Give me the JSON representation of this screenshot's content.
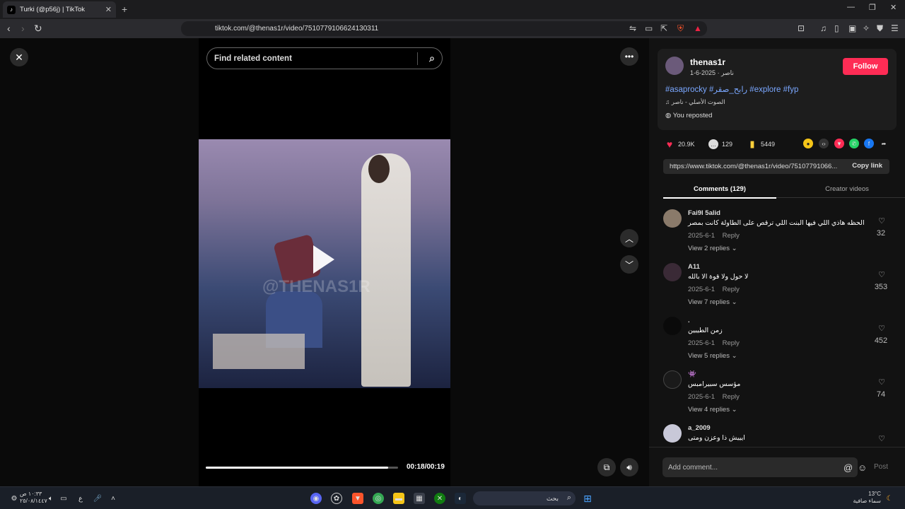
{
  "browser": {
    "tab_title": "Turki (@p56j) | TikTok",
    "url": "tiktok.com/@thenas1r/video/7510779106624130311"
  },
  "player": {
    "search_placeholder": "Find related content",
    "time": "00:18/00:19",
    "watermark": "@THENAS1R",
    "progress_fraction": 0.95
  },
  "post": {
    "username": "thenas1r",
    "subline": "ناصر · 2025-6-1",
    "follow_label": "Follow",
    "hashtags": "#asaprocky #رابح_صقر #explore #fyp",
    "music": "الصوت الأصلي - ناصر",
    "repost": "You reposted",
    "likes": "20.9K",
    "comments_count": "129",
    "saves": "5449",
    "link": "https://www.tiktok.com/@thenas1r/video/75107791066...",
    "copy_label": "Copy link"
  },
  "tabs": {
    "comments": "Comments (129)",
    "creator": "Creator videos"
  },
  "comments": [
    {
      "name": "Fai9l 5alid",
      "text": "الحظه هاذي اللي فيها البنت اللي ترقص على الطاولة كانت بمصر",
      "date": "2025-6-1",
      "reply": "Reply",
      "replies": "View 2 replies",
      "likes": "32"
    },
    {
      "name": "A11",
      "text": "لا حول ولا قوة الا بالله",
      "date": "2025-6-1",
      "reply": "Reply",
      "replies": "View 7 replies",
      "likes": "353"
    },
    {
      "name": ".",
      "text": "زمن الطيبين",
      "date": "2025-6-1",
      "reply": "Reply",
      "replies": "View 5 replies",
      "likes": "452"
    },
    {
      "name": "👾",
      "text": "مؤسس سبيرامبس",
      "date": "2025-6-1",
      "reply": "Reply",
      "replies": "View 4 replies",
      "likes": "74"
    },
    {
      "name": "a_2009",
      "text": "ايييش ذا وعزن ومتى",
      "date": "",
      "reply": "",
      "replies": "",
      "likes": ""
    }
  ],
  "input": {
    "placeholder": "Add comment...",
    "post_label": "Post"
  },
  "taskbar": {
    "search": "بحث",
    "weather_temp": "13°C",
    "weather_desc": "سماء صافية",
    "clock_time": "١٠:٣٣ ص",
    "clock_date": "٢٥/٠٨/١٤٤٧",
    "lang": "ع"
  }
}
